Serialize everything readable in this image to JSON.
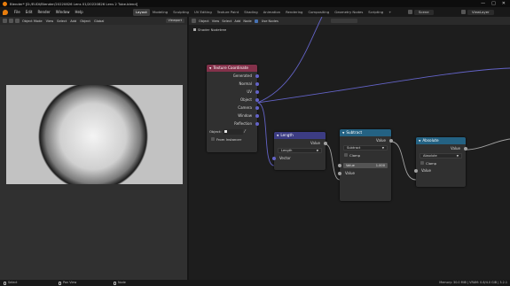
{
  "titlebar": {
    "title": "Blender* [D:/EUDI/Blender/20220826 Lens 01/20220826 Lens 2 Tube.blend]",
    "min": "—",
    "max": "□",
    "close": "✕"
  },
  "menubar": {
    "menus": [
      "File",
      "Edit",
      "Render",
      "Window",
      "Help"
    ],
    "workspaces": [
      "Layout",
      "Modeling",
      "Sculpting",
      "UV Editing",
      "Texture Paint",
      "Shading",
      "Animation",
      "Rendering",
      "Compositing",
      "Geometry Nodes",
      "Scripting",
      "+"
    ],
    "active_workspace": "Layout",
    "scene": "Scene",
    "view_layer": "ViewLayer"
  },
  "left_editor": {
    "mode": "Object Mode",
    "menus": [
      "View",
      "Select",
      "Add",
      "Object"
    ],
    "shading": "Global",
    "view_field": "Viewport"
  },
  "node_editor": {
    "header_menus": [
      "Object",
      "View",
      "Select",
      "Add",
      "Node"
    ],
    "use_nodes": "Use Nodes",
    "breadcrumb": "Shader Nodetree"
  },
  "nodes": {
    "texcoord": {
      "title": "Texture Coordinate",
      "header_color": "#83314a",
      "outputs": [
        "Generated",
        "Normal",
        "UV",
        "Object",
        "Camera",
        "Window",
        "Reflection"
      ],
      "object_label": "Object:",
      "from_instancer": "From Instancer"
    },
    "length": {
      "title": "Length",
      "header_color": "#3c3c83",
      "output": "Value",
      "operation": "Length",
      "input": "Vector"
    },
    "subtract": {
      "title": "Subtract",
      "header_color": "#246283",
      "output": "Value",
      "operation": "Subtract",
      "clamp": "Clamp",
      "value_label": "Value",
      "value": "1.000",
      "input": "Value"
    },
    "absolute": {
      "title": "Absolute",
      "header_color": "#246283",
      "output": "Value",
      "operation": "Absolute",
      "clamp": "Clamp",
      "input": "Value"
    }
  },
  "statusbar": {
    "select": "Select",
    "pan": "Pan View",
    "node": "Node",
    "version": "Memory: 30.0 MiB | VRAM: 0.8/4.0 GiB | 3.2.1"
  },
  "colors": {
    "accent": "#4772b3",
    "vector_socket": "#6363c7",
    "float_socket": "#a1a1a1"
  }
}
